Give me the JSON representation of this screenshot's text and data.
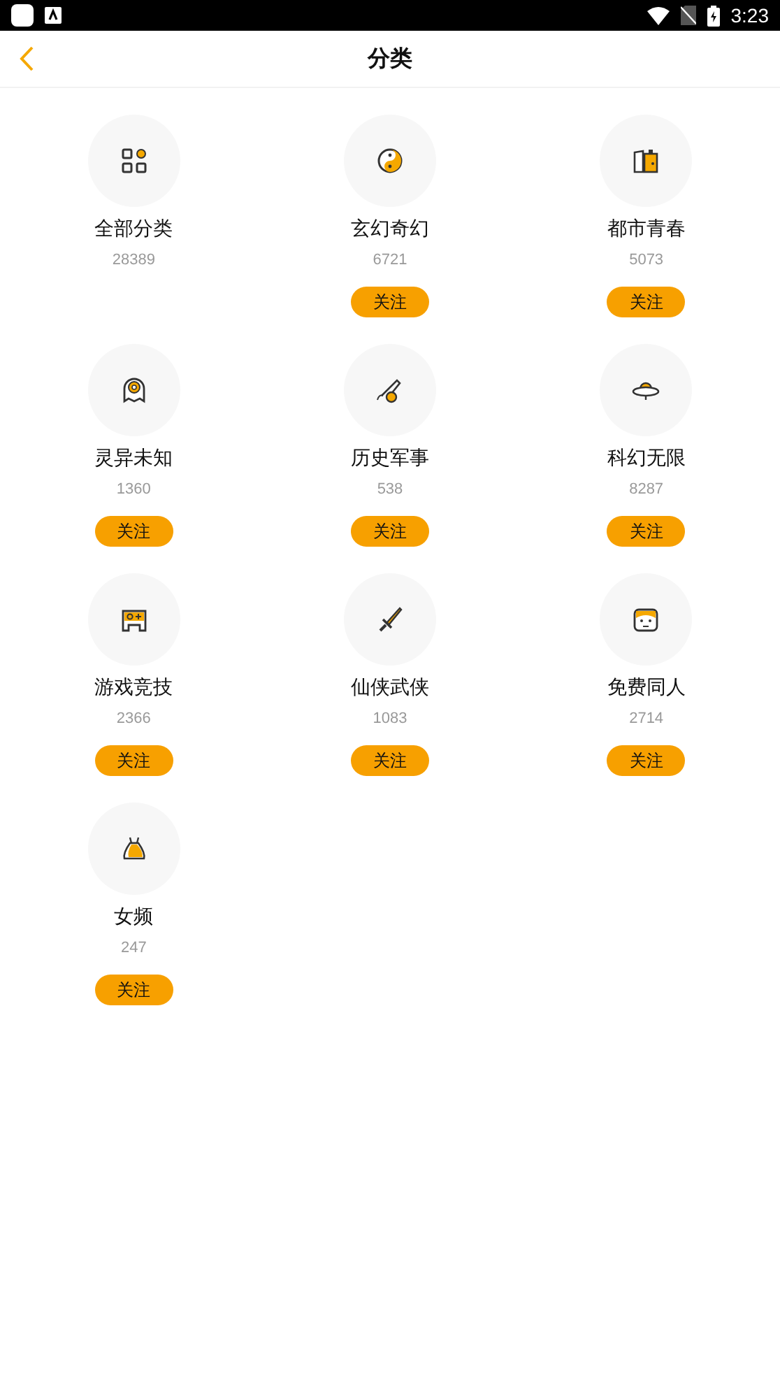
{
  "status_bar": {
    "time": "3:23"
  },
  "header": {
    "title": "分类"
  },
  "categories": [
    {
      "name": "全部分类",
      "count": "28389"
    },
    {
      "name": "玄幻奇幻",
      "count": "6721",
      "follow_button": "关注"
    },
    {
      "name": "都市青春",
      "count": "5073",
      "follow_button": "关注"
    },
    {
      "name": "灵异未知",
      "count": "1360",
      "follow_button": "关注"
    },
    {
      "name": "历史军事",
      "count": "538",
      "follow_button": "关注"
    },
    {
      "name": "科幻无限",
      "count": "8287",
      "follow_button": "关注"
    },
    {
      "name": "游戏竞技",
      "count": "2366",
      "follow_button": "关注"
    },
    {
      "name": "仙侠武侠",
      "count": "1083",
      "follow_button": "关注"
    },
    {
      "name": "免费同人",
      "count": "2714",
      "follow_button": "关注"
    },
    {
      "name": "女频",
      "count": "247",
      "follow_button": "关注"
    }
  ]
}
